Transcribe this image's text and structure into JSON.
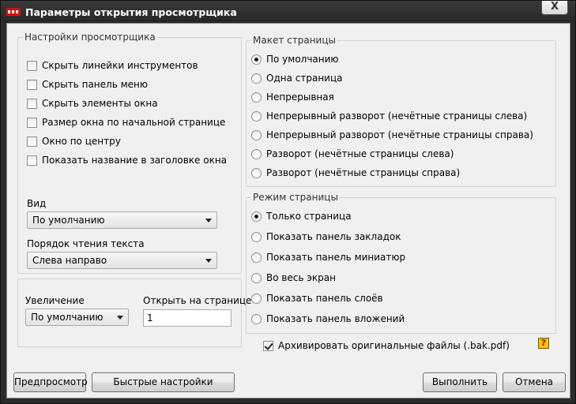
{
  "window": {
    "title": "Параметры открытия просмотрщика",
    "close_glyph": "X"
  },
  "viewer_settings": {
    "legend": "Настройки просмотрщика",
    "options": [
      {
        "label": "Скрыть линейки инструментов",
        "checked": false
      },
      {
        "label": "Скрыть панель меню",
        "checked": false
      },
      {
        "label": "Скрыть элементы окна",
        "checked": false
      },
      {
        "label": "Размер окна по начальной странице",
        "checked": false
      },
      {
        "label": "Окно по центру",
        "checked": false
      },
      {
        "label": "Показать название в заголовке окна",
        "checked": false
      }
    ],
    "view_label": "Вид",
    "view_value": "По умолчанию",
    "reading_order_label": "Порядок чтения текста",
    "reading_order_value": "Слева направо"
  },
  "zoom_section": {
    "zoom_label": "Увеличение",
    "zoom_value": "По умолчанию",
    "open_page_label": "Открыть на странице",
    "open_page_value": "1"
  },
  "page_layout": {
    "legend": "Макет страницы",
    "options": [
      {
        "label": "По умолчанию",
        "checked": true
      },
      {
        "label": "Одна страница",
        "checked": false
      },
      {
        "label": "Непрерывная",
        "checked": false
      },
      {
        "label": "Непрерывный разворот (нечётные страницы слева)",
        "checked": false
      },
      {
        "label": "Непрерывный разворот (нечётные страницы справа)",
        "checked": false
      },
      {
        "label": "Разворот (нечётные страницы слева)",
        "checked": false
      },
      {
        "label": "Разворот (нечётные страницы справа)",
        "checked": false
      }
    ]
  },
  "page_mode": {
    "legend": "Режим страницы",
    "options": [
      {
        "label": "Только страница",
        "checked": true
      },
      {
        "label": "Показать панель закладок",
        "checked": false
      },
      {
        "label": "Показать панель миниатюр",
        "checked": false
      },
      {
        "label": "Во весь экран",
        "checked": false
      },
      {
        "label": "Показать панель слоёв",
        "checked": false
      },
      {
        "label": "Показать панель вложений",
        "checked": false
      }
    ]
  },
  "archive": {
    "label": "Архивировать оригинальные файлы (.bak.pdf)",
    "checked": true,
    "help_glyph": "?"
  },
  "buttons": {
    "preview": "Предпросмотр",
    "quick_settings": "Быстрые настройки",
    "run": "Выполнить",
    "cancel": "Отмена"
  },
  "colors": {
    "title_bar": "#2b2b2b",
    "client_bg": "#f0f0f0",
    "help_icon": "#f2c500"
  }
}
